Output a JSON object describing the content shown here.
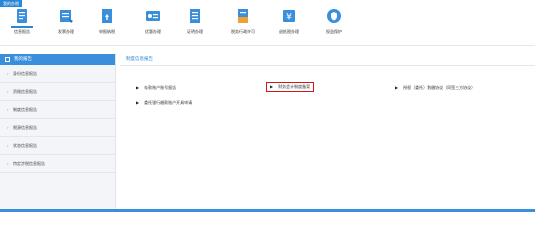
{
  "home_tag": "我的办税",
  "toolbar": [
    {
      "label": "信息报告",
      "icon": "report-icon",
      "color": "#3a8fdc"
    },
    {
      "label": "发票办理",
      "icon": "invoice-icon",
      "color": "#3a8fdc"
    },
    {
      "label": "申报纳税",
      "icon": "tax-declare-icon",
      "color": "#3a8fdc"
    },
    {
      "label": "优惠办理",
      "icon": "discount-icon",
      "color": "#3a8fdc"
    },
    {
      "label": "证明办理",
      "icon": "certificate-icon",
      "color": "#3a8fdc"
    },
    {
      "label": "税务行政许可",
      "icon": "license-icon",
      "color": "#3a8fdc"
    },
    {
      "label": "退抵税办理",
      "icon": "refund-icon",
      "color": "#3a8fdc"
    },
    {
      "label": "权益保护",
      "icon": "shield-icon",
      "color": "#3a8fdc"
    }
  ],
  "sidebar": {
    "header": "我的报告",
    "items": [
      {
        "label": "身份信息报告"
      },
      {
        "label": "资格信息报告"
      },
      {
        "label": "制度信息报告"
      },
      {
        "label": "税源信息报告"
      },
      {
        "label": "状态信息报告"
      },
      {
        "label": "特定涉税信息报告"
      }
    ]
  },
  "main": {
    "header": "制度信息报告",
    "links": [
      {
        "label": "存款账户账号报告"
      },
      {
        "label": "财务会计制度备案"
      },
      {
        "label": "授权（委托）划缴协议（同签三方协议）"
      },
      {
        "label": "委托银行缴款账户开具申请"
      }
    ]
  },
  "colors": {
    "accent": "#3a8fdc",
    "highlight": "#d01818"
  }
}
